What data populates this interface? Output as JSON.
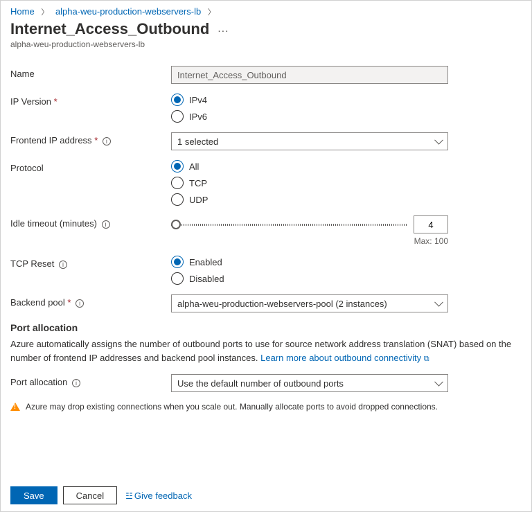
{
  "breadcrumb": {
    "home": "Home",
    "parent": "alpha-weu-production-webservers-lb"
  },
  "header": {
    "title": "Internet_Access_Outbound",
    "subtitle": "alpha-weu-production-webservers-lb"
  },
  "fields": {
    "name": {
      "label": "Name",
      "value": "Internet_Access_Outbound"
    },
    "ip_version": {
      "label": "IP Version",
      "opt1": "IPv4",
      "opt2": "IPv6"
    },
    "frontend_ip": {
      "label": "Frontend IP address",
      "value": "1 selected"
    },
    "protocol": {
      "label": "Protocol",
      "opt1": "All",
      "opt2": "TCP",
      "opt3": "UDP"
    },
    "idle_timeout": {
      "label": "Idle timeout (minutes)",
      "value": "4",
      "max": "Max: 100"
    },
    "tcp_reset": {
      "label": "TCP Reset",
      "opt1": "Enabled",
      "opt2": "Disabled"
    },
    "backend_pool": {
      "label": "Backend pool",
      "value": "alpha-weu-production-webservers-pool (2 instances)"
    }
  },
  "port_allocation": {
    "heading": "Port allocation",
    "description": "Azure automatically assigns the number of outbound ports to use for source network address translation (SNAT) based on the number of frontend IP addresses and backend pool instances. ",
    "link_text": "Learn more about outbound connectivity",
    "label": "Port allocation",
    "value": "Use the default number of outbound ports"
  },
  "alert": "Azure may drop existing connections when you scale out. Manually allocate ports to avoid dropped connections.",
  "footer": {
    "save": "Save",
    "cancel": "Cancel",
    "feedback": "Give feedback"
  }
}
